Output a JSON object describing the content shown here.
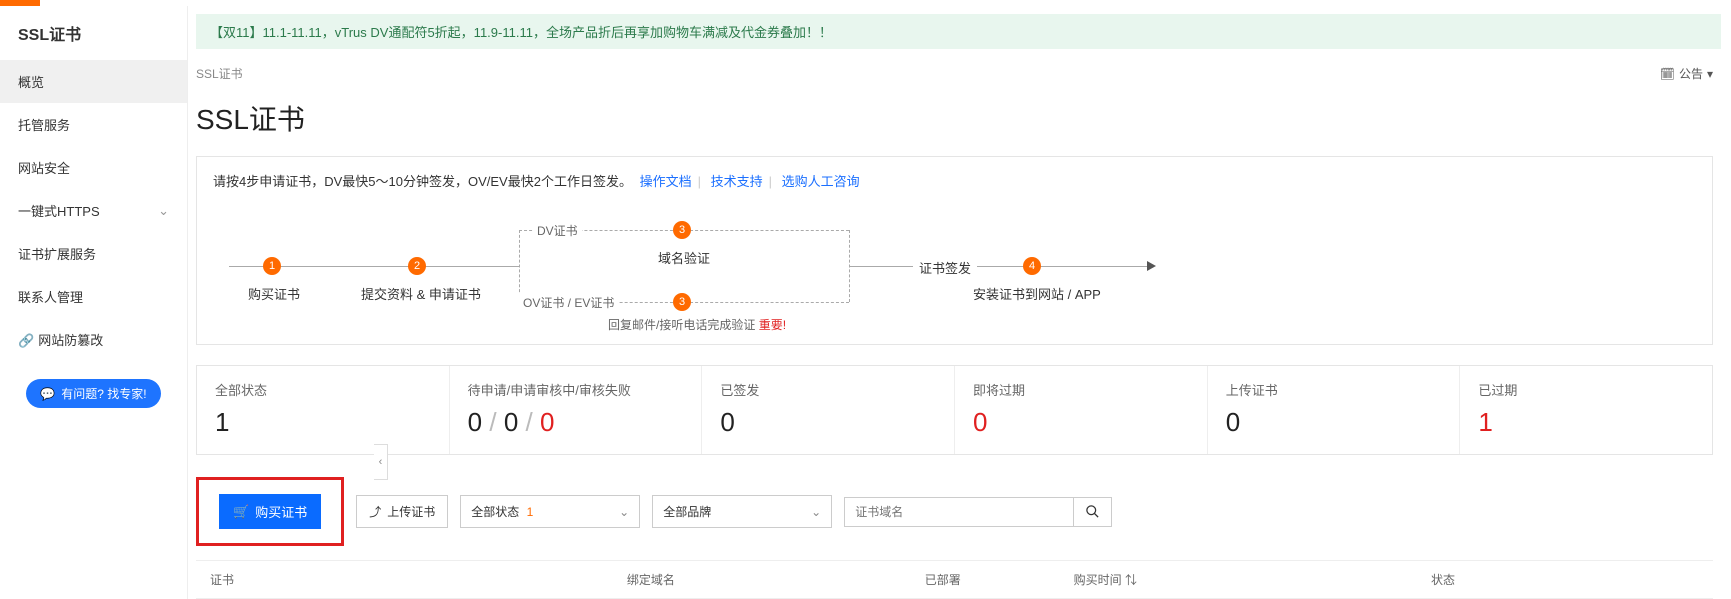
{
  "banner": "【双11】11.1-11.11，vTrus DV通配符5折起，11.9-11.11，全场产品折后再享加购物车满减及代金券叠加！！",
  "sidebar": {
    "title": "SSL证书",
    "items": [
      {
        "label": "概览",
        "active": true
      },
      {
        "label": "托管服务"
      },
      {
        "label": "网站安全"
      },
      {
        "label": "一键式HTTPS",
        "expandable": true
      },
      {
        "label": "证书扩展服务"
      },
      {
        "label": "联系人管理"
      },
      {
        "label": "网站防篡改",
        "icon": "link"
      }
    ],
    "help_btn": "有问题? 找专家!"
  },
  "breadcrumb": "SSL证书",
  "notice_text": "公告",
  "page_title": "SSL证书",
  "hint": {
    "text_a": "请按4步申请证书，DV最快5～10分钟签发，OV/EV最快2个工作日签发。",
    "link1": "操作文档",
    "link2": "技术支持",
    "link3": "选购人工咨询"
  },
  "diagram": {
    "s1_num": "1",
    "s1_label": "购买证书",
    "s2_num": "2",
    "s2_label": "提交资料 & 申请证书",
    "dv_label": "DV证书",
    "ov_label": "OV证书 / EV证书",
    "s3_num": "3",
    "s3_label": "域名验证",
    "s3b_num": "3",
    "reply": "回复邮件/接听电话完成验证",
    "important": "重要!",
    "sign": "证书签发",
    "s4_num": "4",
    "s4_label": "安装证书到网站 / APP"
  },
  "stats": [
    {
      "label": "全部状态",
      "html": "1"
    },
    {
      "label": "待申请/申请审核中/审核失败",
      "html": "0 <span class='g'>/</span> 0 <span class='g'>/</span> <span class='r'>0</span>"
    },
    {
      "label": "已签发",
      "html": "0"
    },
    {
      "label": "即将过期",
      "html": "<span class='r'>0</span>"
    },
    {
      "label": "上传证书",
      "html": "0"
    },
    {
      "label": "已过期",
      "html": "<span class='r'>1</span>"
    }
  ],
  "toolbar": {
    "buy": "购买证书",
    "upload": "上传证书",
    "sel_status": "全部状态",
    "sel_status_count": "1",
    "sel_brand": "全部品牌",
    "search_ph": "证书域名"
  },
  "table_heads": [
    "证书",
    "绑定域名",
    "已部署",
    "购买时间",
    "状态"
  ]
}
